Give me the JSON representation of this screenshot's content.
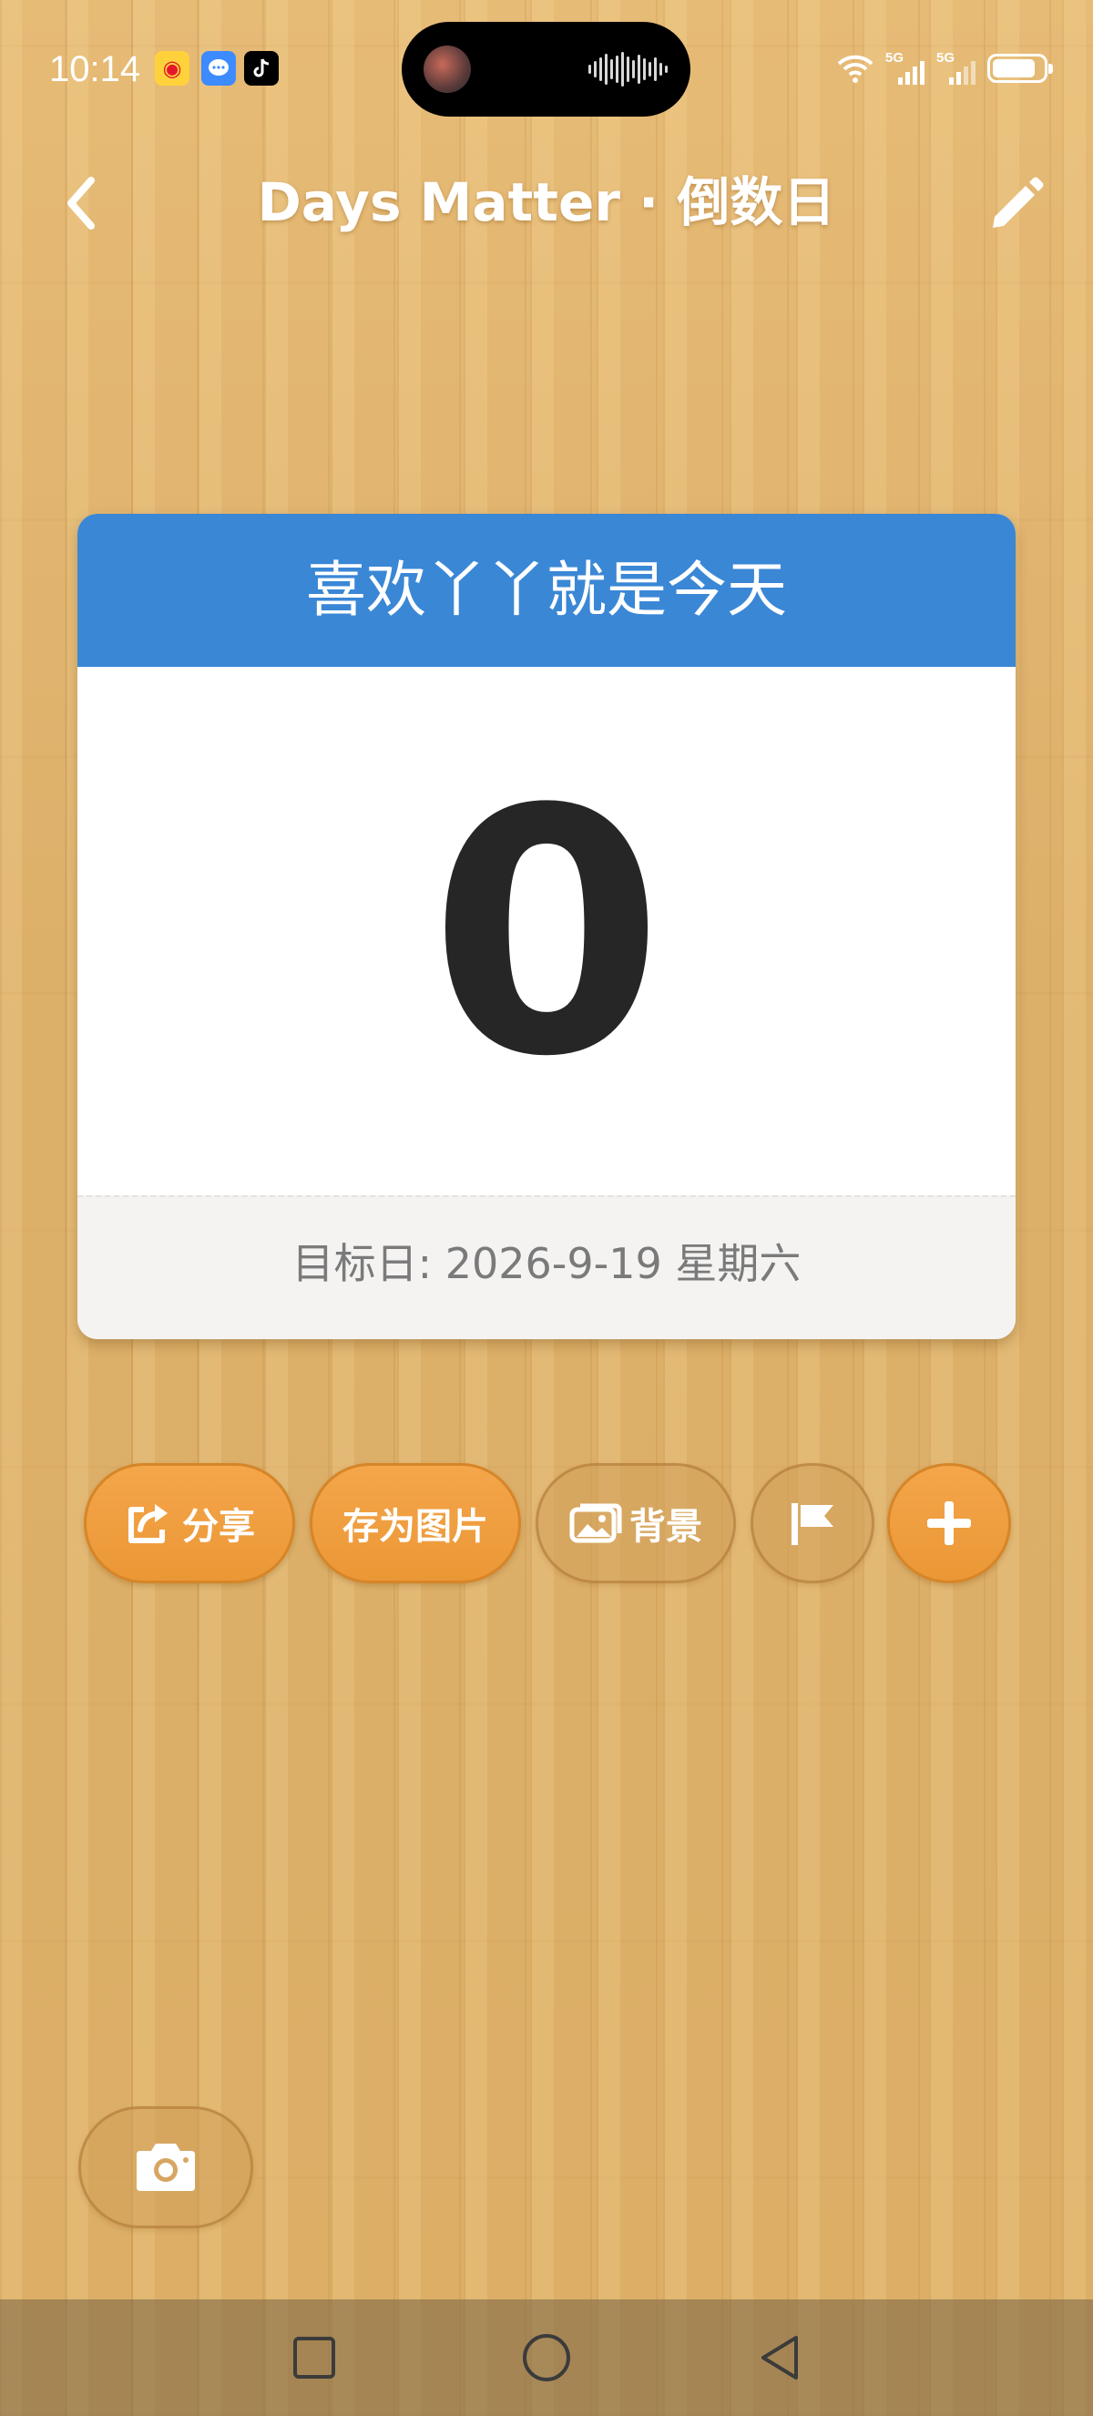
{
  "status_bar": {
    "time": "10:14",
    "apps": [
      "weibo-icon",
      "message-icon",
      "tiktok-icon"
    ],
    "network_1": "5G",
    "network_2": "5G",
    "battery_level": 0.85
  },
  "header": {
    "title": "Days Matter · 倒数日",
    "back_icon": "chevron-left-icon",
    "edit_icon": "pencil-icon"
  },
  "card": {
    "title": "喜欢丫丫就是今天",
    "count": "0",
    "target_date": "目标日: 2026-9-19 星期六",
    "header_color": "#3a87d6"
  },
  "actions": {
    "share_label": "分享",
    "save_image_label": "存为图片",
    "background_label": "背景",
    "flag_icon": "flag-icon",
    "add_icon": "plus-icon",
    "accent_color": "#f0a040"
  },
  "camera_icon": "camera-icon",
  "nav_bar": {
    "recent_icon": "square-icon",
    "home_icon": "circle-icon",
    "back_icon": "triangle-back-icon"
  }
}
